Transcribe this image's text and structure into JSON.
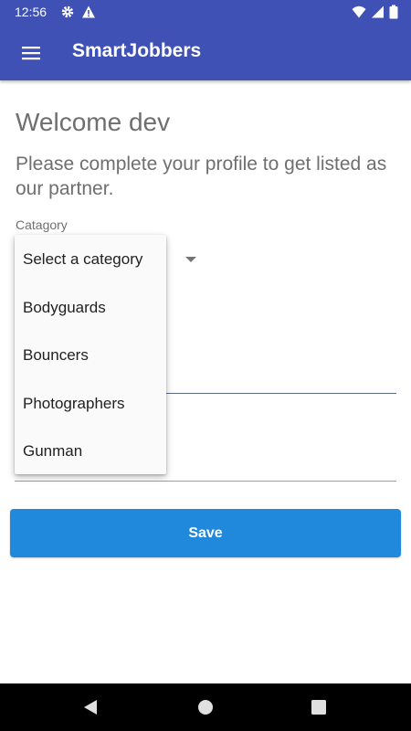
{
  "status_bar": {
    "time": "12:56",
    "icons": [
      "settings-icon",
      "alert-icon",
      "wifi-icon",
      "signal-icon",
      "battery-icon"
    ]
  },
  "app_bar": {
    "title": "SmartJobbers",
    "menu_icon": "hamburger-menu-icon"
  },
  "welcome": "Welcome dev",
  "subtitle": "Please complete your profile to get listed as our partner.",
  "category_field": {
    "label": "Catagory",
    "selected": "Select a category",
    "options": [
      "Select a category",
      "Bodyguards",
      "Bouncers",
      "Photographers",
      "Gunman"
    ]
  },
  "save_button": {
    "label": "Save"
  },
  "nav_bar": {
    "icons": [
      "back-icon",
      "home-icon",
      "recents-icon"
    ]
  },
  "colors": {
    "primary": "#3f51b5",
    "button": "#2089dc",
    "text_secondary": "#6f6f6f",
    "menu_background": "#fafafa"
  }
}
